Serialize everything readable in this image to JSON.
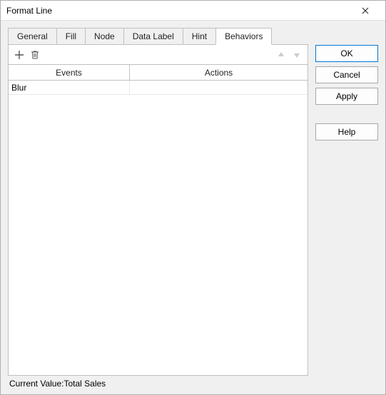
{
  "window": {
    "title": "Format Line"
  },
  "tabs": {
    "general": "General",
    "fill": "Fill",
    "node": "Node",
    "data_label": "Data Label",
    "hint": "Hint",
    "behaviors": "Behaviors",
    "active": "behaviors"
  },
  "table": {
    "headers": {
      "events": "Events",
      "actions": "Actions"
    },
    "rows": [
      {
        "event": "Blur",
        "action": ""
      }
    ]
  },
  "status": {
    "label": "Current Value:",
    "value": "Total Sales"
  },
  "buttons": {
    "ok": "OK",
    "cancel": "Cancel",
    "apply": "Apply",
    "help": "Help"
  }
}
